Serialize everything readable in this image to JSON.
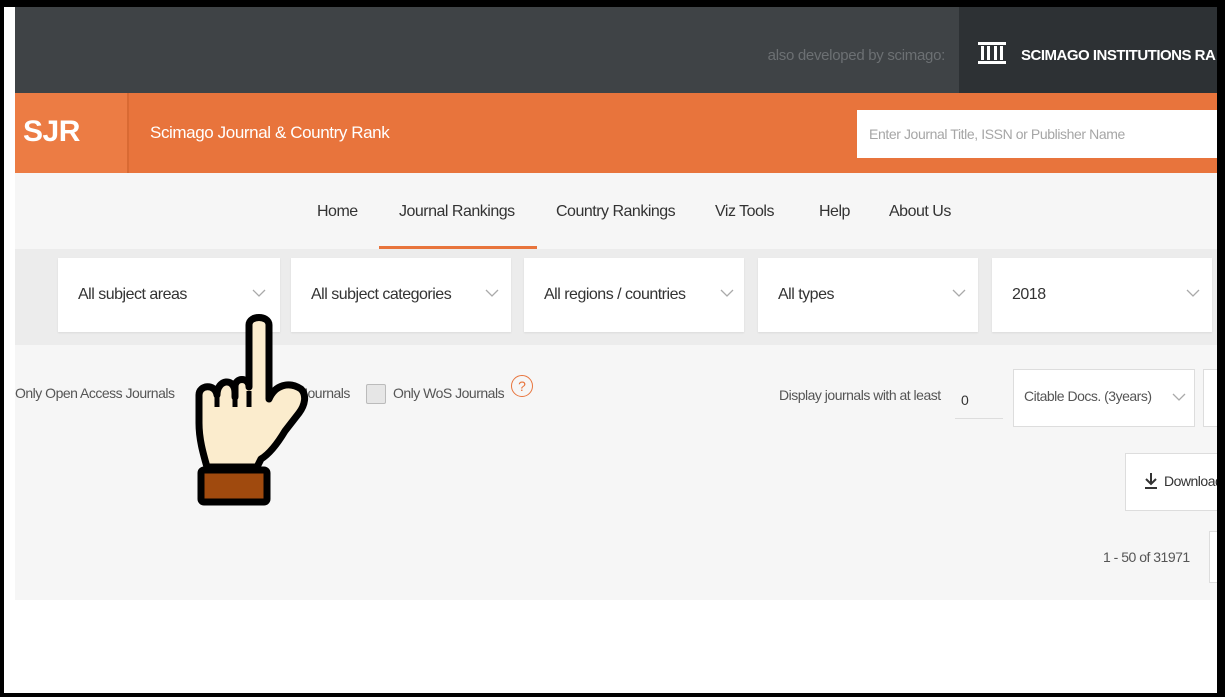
{
  "topbar": {
    "also_developed": "also developed by scimago:",
    "sir_label": "SCIMAGO INSTITUTIONS RA",
    "sir_icon": "institution-columns-icon"
  },
  "header": {
    "logo": "SJR",
    "title": "Scimago Journal & Country Rank",
    "search_placeholder": "Enter Journal Title, ISSN or Publisher Name"
  },
  "nav": {
    "items": [
      {
        "label": "Home"
      },
      {
        "label": "Journal Rankings",
        "active": true
      },
      {
        "label": "Country Rankings"
      },
      {
        "label": "Viz Tools"
      },
      {
        "label": "Help"
      },
      {
        "label": "About Us"
      }
    ]
  },
  "filters": {
    "subject_areas": "All subject areas",
    "subject_categories": "All subject categories",
    "regions": "All regions / countries",
    "types": "All types",
    "year": "2018"
  },
  "options": {
    "open_access": "Only Open Access Journals",
    "scielo_partial": "Journals",
    "wos": "Only WoS Journals",
    "help_glyph": "?",
    "display_at_least": "Display journals with at least",
    "min_value": "0",
    "citable_docs": "Citable Docs. (3years)",
    "download": "Download",
    "pagination": "1 - 50 of 31971"
  },
  "colors": {
    "accent": "#e8743c",
    "topbar": "#3f4346"
  },
  "cursor": {
    "icon": "pointing-hand-cursor-icon"
  }
}
